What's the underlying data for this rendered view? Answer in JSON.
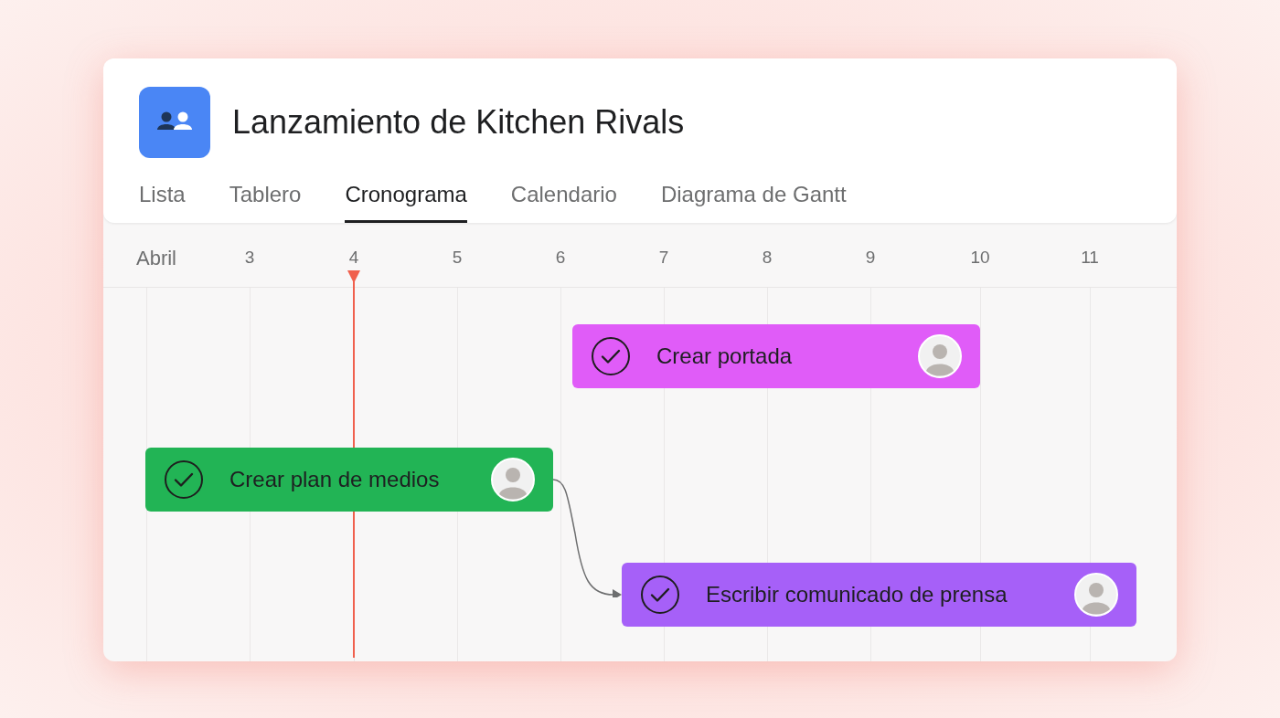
{
  "project": {
    "title": "Lanzamiento de Kitchen Rivals"
  },
  "tabs": [
    {
      "label": "Lista",
      "selected": false
    },
    {
      "label": "Tablero",
      "selected": false
    },
    {
      "label": "Cronograma",
      "selected": true
    },
    {
      "label": "Calendario",
      "selected": false
    },
    {
      "label": "Diagrama de Gantt",
      "selected": false
    }
  ],
  "timeline": {
    "month": "Abril",
    "days": [
      {
        "label": "3",
        "current": false
      },
      {
        "label": "4",
        "current": true
      },
      {
        "label": "5",
        "current": false
      },
      {
        "label": "6",
        "current": false
      },
      {
        "label": "7",
        "current": false
      },
      {
        "label": "8",
        "current": false
      },
      {
        "label": "9",
        "current": false
      },
      {
        "label": "10",
        "current": false
      },
      {
        "label": "11",
        "current": false
      }
    ],
    "tasks": [
      {
        "name": "Crear portada",
        "color": "#e05cf8"
      },
      {
        "name": "Crear plan de medios",
        "color": "#22b455"
      },
      {
        "name": "Escribir comunicado de prensa",
        "color": "#a660f8"
      }
    ]
  }
}
